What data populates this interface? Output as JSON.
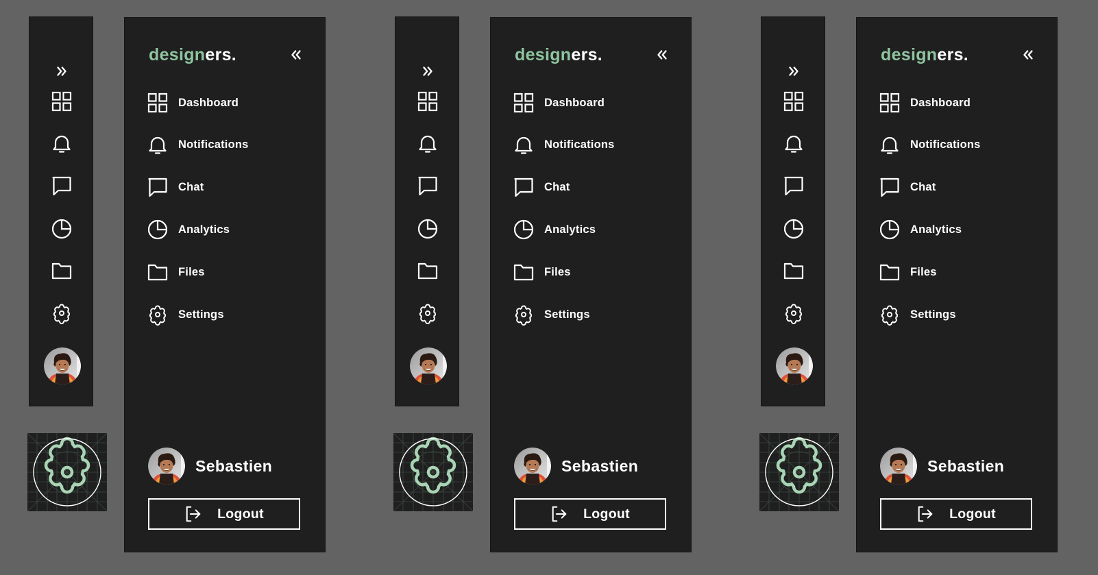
{
  "colors": {
    "background": "#636363",
    "panel": "#1f1f1f",
    "accent": "#8fc4a0",
    "text": "#ffffff"
  },
  "brand": {
    "accent_part": "design",
    "rest_part": "ers."
  },
  "nav": [
    {
      "label": "Dashboard",
      "icon": "dashboard-grid-icon"
    },
    {
      "label": "Notifications",
      "icon": "bell-icon"
    },
    {
      "label": "Chat",
      "icon": "chat-bubble-icon"
    },
    {
      "label": "Analytics",
      "icon": "pie-chart-icon"
    },
    {
      "label": "Files",
      "icon": "folder-icon"
    },
    {
      "label": "Settings",
      "icon": "gear-icon"
    }
  ],
  "user": {
    "name": "Sebastien",
    "avatar": "user-avatar-photo"
  },
  "logout": {
    "label": "Logout",
    "icon": "logout-icon"
  },
  "rail": {
    "expand_icon": "chevrons-right-icon"
  },
  "panel_collapse_icon": "chevrons-left-icon",
  "illustration": {
    "icon": "gear-construction-grid-icon"
  }
}
